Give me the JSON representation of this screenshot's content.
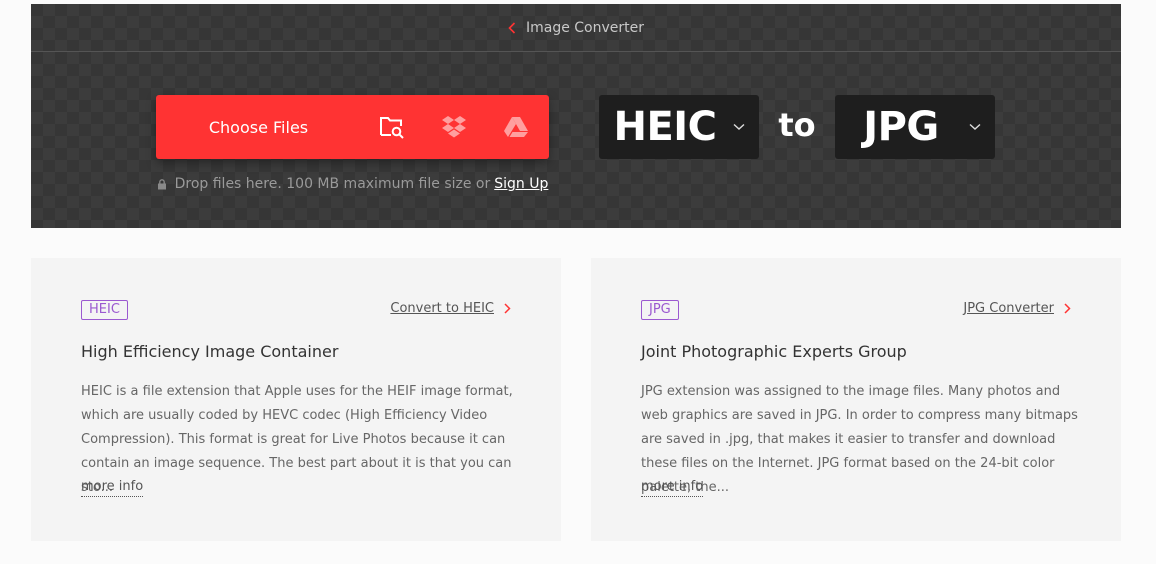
{
  "breadcrumb": {
    "label": "Image Converter"
  },
  "upload": {
    "choose_files_label": "Choose Files",
    "sources": [
      "folder-search-icon",
      "dropbox-icon",
      "google-drive-icon"
    ],
    "drop_note": "Drop files here. 100 MB maximum file size or",
    "signup_label": "Sign Up"
  },
  "converter": {
    "from_format": "HEIC",
    "to_label": "to",
    "to_format": "JPG"
  },
  "colors": {
    "accent": "#ff3333",
    "badge": "#9b59d0",
    "hero_bg": "#363636",
    "select_bg": "#1e1e1e"
  },
  "cards": [
    {
      "badge": "HEIC",
      "link_label": "Convert to HEIC",
      "title": "High Efficiency Image Container",
      "description": "HEIC is a file extension that Apple uses for the HEIF image format, which are usually coded by HEVC codec (High Efficiency Video Compression). This format is great for Live Photos because it can contain an image sequence. The best part about it is that you can sto...",
      "more_label": "more info"
    },
    {
      "badge": "JPG",
      "link_label": "JPG Converter",
      "title": "Joint Photographic Experts Group",
      "description": "JPG extension was assigned to the image files. Many photos and web graphics are saved in JPG. In order to compress many bitmaps are saved in .jpg, that makes it easier to transfer and download these files on the Internet. JPG format based on the 24-bit color palette, the...",
      "more_label": "more info"
    }
  ]
}
